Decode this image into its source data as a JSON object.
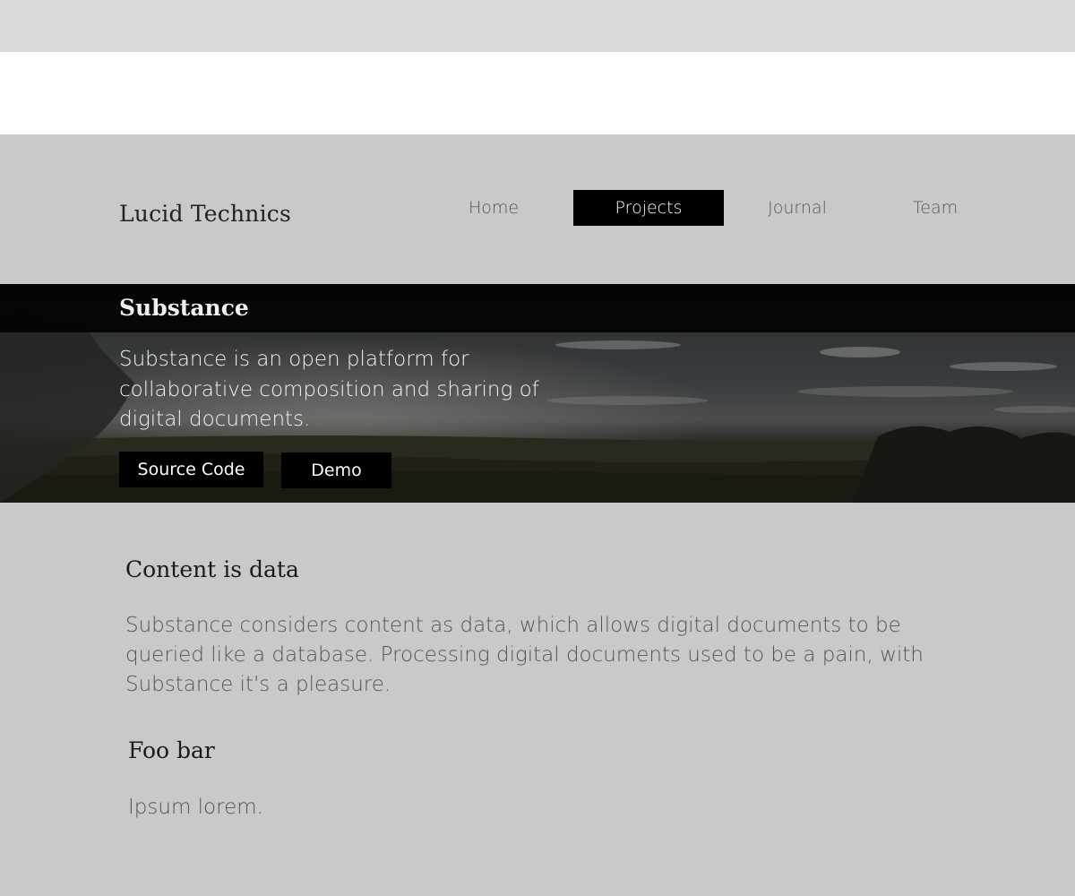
{
  "header": {
    "brand": "Lucid Technics",
    "nav": [
      {
        "label": "Home",
        "active": false
      },
      {
        "label": "Projects",
        "active": true
      },
      {
        "label": "Journal",
        "active": false
      },
      {
        "label": "Team",
        "active": false
      }
    ]
  },
  "hero": {
    "title": "Substance",
    "description": "Substance is an open platform for collaborative composition and sharing of digital documents.",
    "buttons": {
      "source_code": "Source Code",
      "demo": "Demo"
    }
  },
  "sections": [
    {
      "heading": "Content is data",
      "body": "Substance considers content as data, which allows digital documents to be queried like a database. Processing digital documents used to be a pain, with Substance it's a pleasure."
    },
    {
      "heading": "Foo bar",
      "body": "Ipsum lorem."
    }
  ],
  "colors": {
    "page_background": "#c9c9c9",
    "active_nav": "#000000",
    "button_background": "#000000"
  }
}
